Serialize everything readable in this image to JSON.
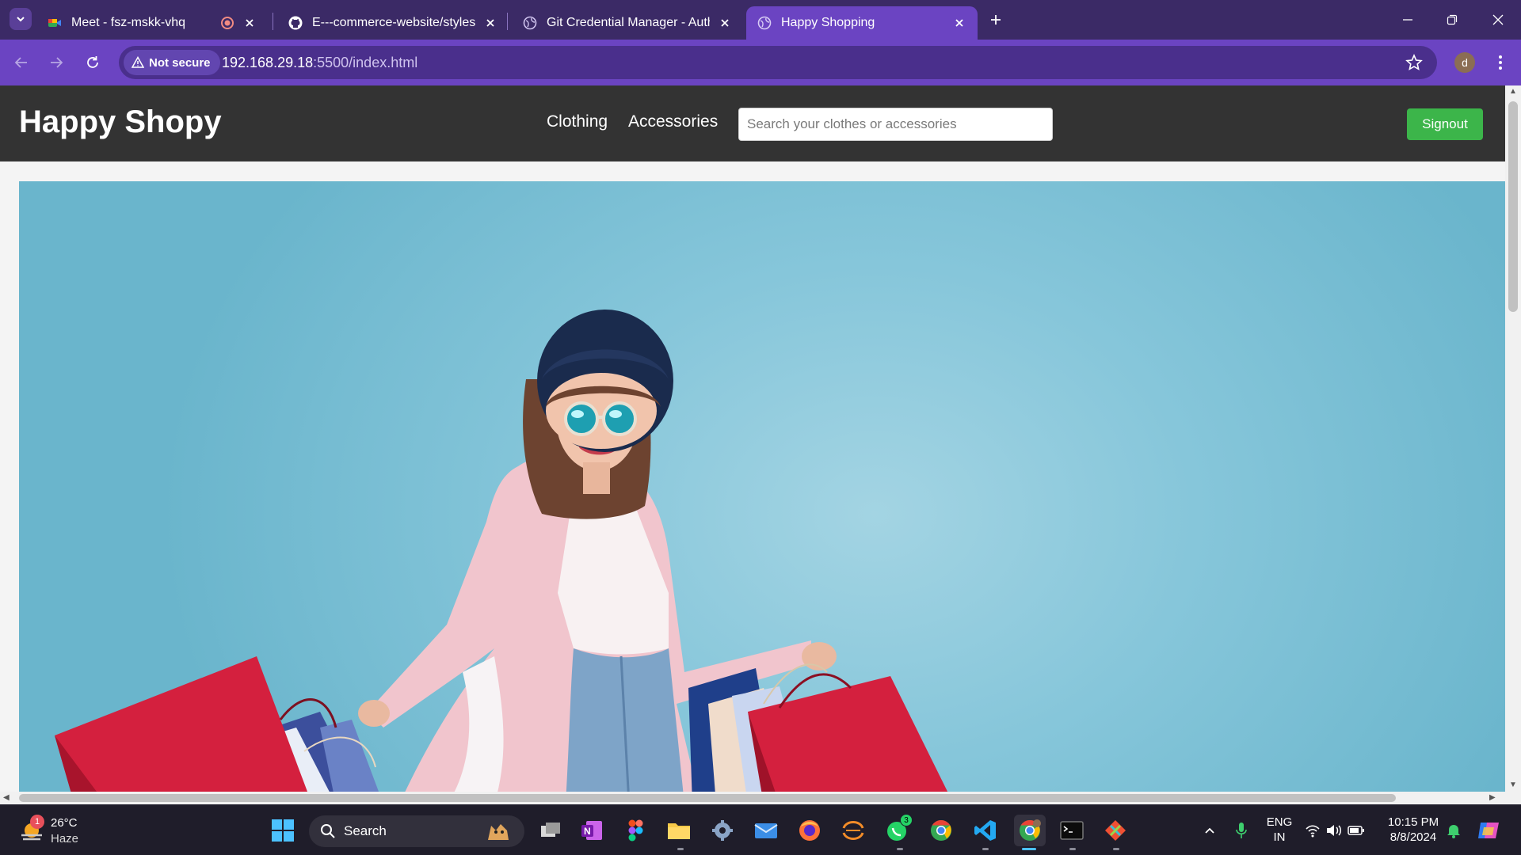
{
  "browser": {
    "tabs": [
      {
        "title": "Meet - fsz-mskk-vhq",
        "favicon": "google-meet-icon",
        "recording": true
      },
      {
        "title": "E---commerce-website/styles.css",
        "favicon": "github-icon"
      },
      {
        "title": "Git Credential Manager - Authentication",
        "favicon": "globe-icon"
      },
      {
        "title": "Happy Shopping",
        "favicon": "globe-icon",
        "active": true
      }
    ],
    "security_label": "Not secure",
    "url_host": "192.168.29.18",
    "url_rest": ":5500/index.html",
    "profile_initial": "d"
  },
  "site": {
    "logo": "Happy Shopy",
    "nav": [
      "Clothing",
      "Accessories"
    ],
    "search_placeholder": "Search your clothes or accessories",
    "signout_label": "Signout",
    "colors": {
      "header_bg": "#333333",
      "signout_bg": "#3cb54a",
      "hero_bg": "#86c6da"
    }
  },
  "taskbar": {
    "weather": {
      "temp": "26°C",
      "condition": "Haze",
      "badge": "1"
    },
    "search_label": "Search",
    "whatsapp_badge": "3",
    "language_line1": "ENG",
    "language_line2": "IN",
    "time": "10:15 PM",
    "date": "8/8/2024"
  }
}
